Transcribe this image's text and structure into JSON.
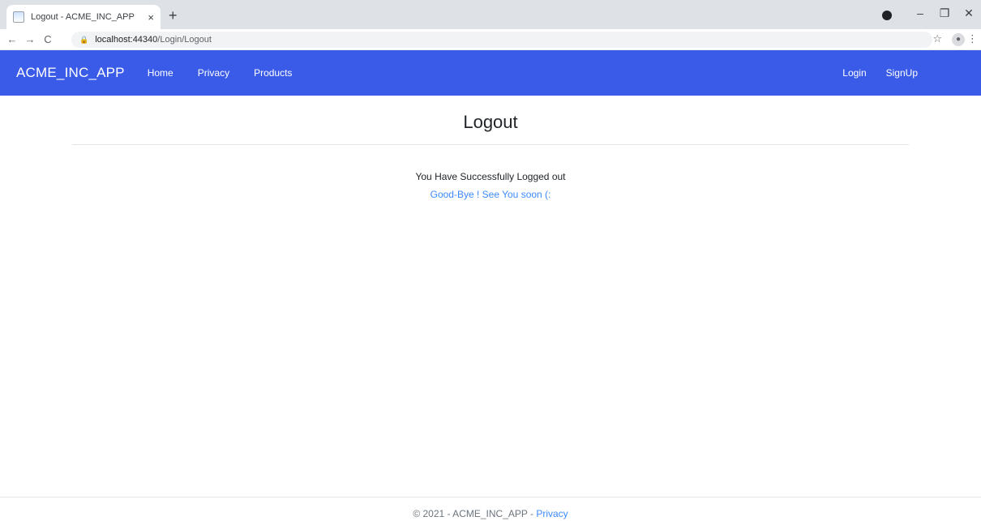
{
  "browser": {
    "tab_title": "Logout - ACME_INC_APP",
    "tab_close": "×",
    "new_tab": "+",
    "url_host": "localhost:44340",
    "url_path": "/Login/Logout",
    "back": "←",
    "forward": "→",
    "reload": "C",
    "lock": "🔒",
    "star": "☆",
    "menu": "⋮",
    "minimize": "–",
    "restore": "❐",
    "close": "✕"
  },
  "navbar": {
    "brand": "ACME_INC_APP",
    "links": [
      "Home",
      "Privacy",
      "Products"
    ],
    "right_links": [
      "Login",
      "SignUp"
    ]
  },
  "main": {
    "title": "Logout",
    "message": "You Have Successfully Logged out",
    "farewell": "Good-Bye ! See You soon (:"
  },
  "footer": {
    "text": "© 2021 - ACME_INC_APP - ",
    "privacy_link": "Privacy"
  },
  "colors": {
    "navbar_bg": "#3a5be8",
    "link": "#3d8bfd"
  }
}
